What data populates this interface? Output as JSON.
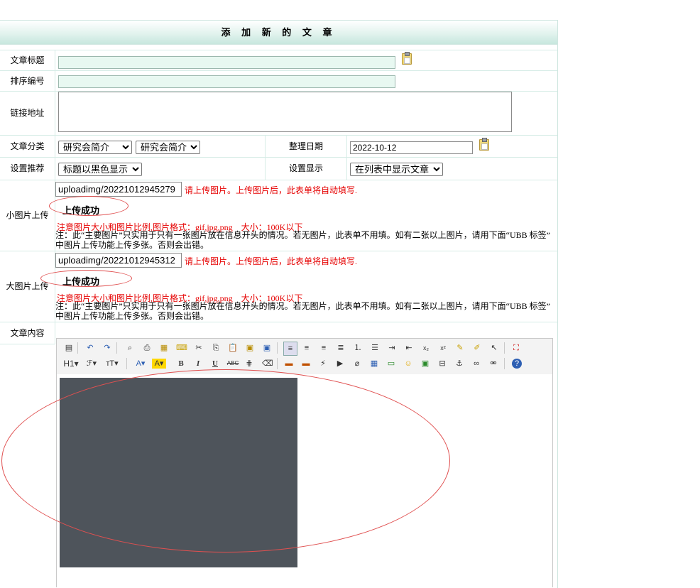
{
  "page_title": "添 加 新 的 文 章",
  "fields": {
    "title_label": "文章标题",
    "title_value": "",
    "sort_label": "排序编号",
    "sort_value": "",
    "link_label": "链接地址",
    "link_value": "",
    "category_label": "文章分类",
    "category_1": "研究会简介",
    "category_2": "研究会简介",
    "date_label": "整理日期",
    "date_value": "2022-10-12",
    "recommend_label": "设置推荐",
    "recommend_value": "标题以黑色显示",
    "display_label": "设置显示",
    "display_value": "在列表中显示文章"
  },
  "small_image": {
    "label": "小图片上传",
    "path_value": "uploadimg/20221012945279",
    "hint": "请上传图片。上传图片后，此表单将自动填写.",
    "status": "上传成功",
    "size_note": "注意图片大小和图片比例,图片格式：gif,jpg,png　大小：100K以下",
    "note_line1": "注：此“主要图片”只实用于只有一张图片放在信息开头的情况。若无图片，此表单不用填。如有二张以上图片，请用下面“UBB 标签”",
    "note_line2": "中图片上传功能上传多张。否则会出错。"
  },
  "large_image": {
    "label": "大图片上传",
    "path_value": "uploadimg/20221012945312",
    "hint": "请上传图片。上传图片后，此表单将自动填写.",
    "status": "上传成功",
    "size_note": "注意图片大小和图片比例,图片格式：gif,jpg,png　大小：100K以下",
    "note_line1": "注：此“主要图片”只实用于只有一张图片放在信息开头的情况。若无图片，此表单不用填。如有二张以上图片，请用下面“UBB 标签”",
    "note_line2": "中图片上传功能上传多张。否则会出错。"
  },
  "content": {
    "label": "文章内容",
    "toolbar_row1": [
      "source-icon",
      "undo-icon",
      "redo-icon",
      "preview-icon",
      "print-icon",
      "template-icon",
      "code-icon",
      "cut-icon",
      "copy-icon",
      "paste-icon",
      "paste-text-icon",
      "paste-word-icon",
      "align-left-icon",
      "align-center-icon",
      "align-right-icon",
      "justify-icon",
      "ordered-list-icon",
      "unordered-list-icon",
      "indent-icon",
      "outdent-icon",
      "subscript-icon",
      "superscript-icon",
      "clear-format-icon",
      "select-all-icon",
      "cursor-icon",
      "fullscreen-icon"
    ],
    "toolbar_row2": [
      "heading-icon",
      "font-family-icon",
      "font-size-icon",
      "font-color-icon",
      "highlight-icon",
      "bold-icon",
      "italic-icon",
      "underline-icon",
      "strikethrough-icon",
      "line-height-icon",
      "eraser-icon",
      "image-icon",
      "multi-image-icon",
      "flash-icon",
      "media-icon",
      "attach-icon",
      "table-icon",
      "hr-icon",
      "emoticon-icon",
      "map-icon",
      "page-break-icon",
      "anchor-icon",
      "link-icon",
      "unlink-icon",
      "help-icon"
    ],
    "btn_h1": "H1",
    "btn_bold": "B",
    "btn_italic": "I",
    "btn_underline": "U",
    "btn_strike": "ABC"
  }
}
